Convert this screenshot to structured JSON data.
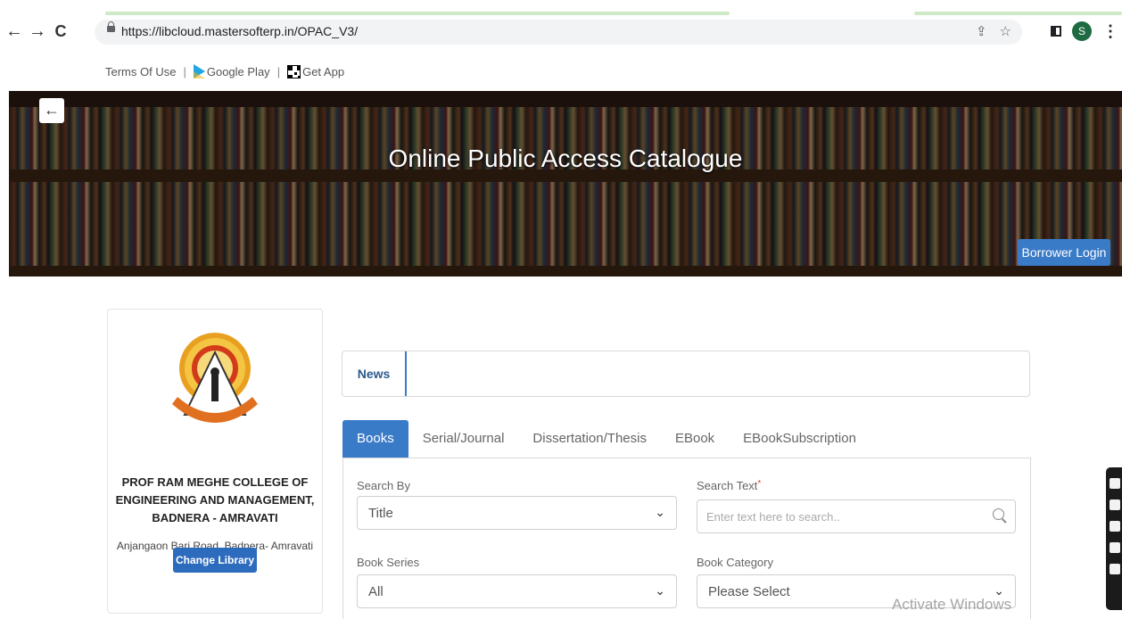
{
  "browser": {
    "url": "https://libcloud.mastersofterp.in/OPAC_V3/",
    "profile_initial": "S",
    "back": "←",
    "forward": "→",
    "reload": "C",
    "share_glyph": "⇪",
    "star_glyph": "☆",
    "menu_glyph": "⋮"
  },
  "top_links": {
    "terms": "Terms Of Use",
    "sep": "|",
    "google_play": "Google Play",
    "get_app": "Get App"
  },
  "hero": {
    "title": "Online Public Access Catalogue",
    "back_glyph": "←",
    "login_label": "Borrower Login"
  },
  "library": {
    "name_lines": [
      "PROF RAM MEGHE COLLEGE OF",
      "ENGINEERING AND MANAGEMENT,",
      "BADNERA - AMRAVATI"
    ],
    "address": "Anjangaon Bari Road, Badnera- Amravati",
    "change_label": "Change Library"
  },
  "news": {
    "label": "News"
  },
  "tabs": [
    {
      "label": "Books",
      "active": true
    },
    {
      "label": "Serial/Journal",
      "active": false
    },
    {
      "label": "Dissertation/Thesis",
      "active": false
    },
    {
      "label": "EBook",
      "active": false
    },
    {
      "label": "EBookSubscription",
      "active": false
    }
  ],
  "form": {
    "search_by": {
      "label": "Search By",
      "value": "Title"
    },
    "search_text": {
      "label": "Search Text",
      "required": "*",
      "placeholder": "Enter text here to search.."
    },
    "book_series": {
      "label": "Book Series",
      "value": "All"
    },
    "book_category": {
      "label": "Book Category",
      "value": "Please Select"
    },
    "chevron": "⌄"
  },
  "watermark": "Activate Windows",
  "colors": {
    "primary": "#3a7bc8",
    "button": "#2d6bbd"
  }
}
